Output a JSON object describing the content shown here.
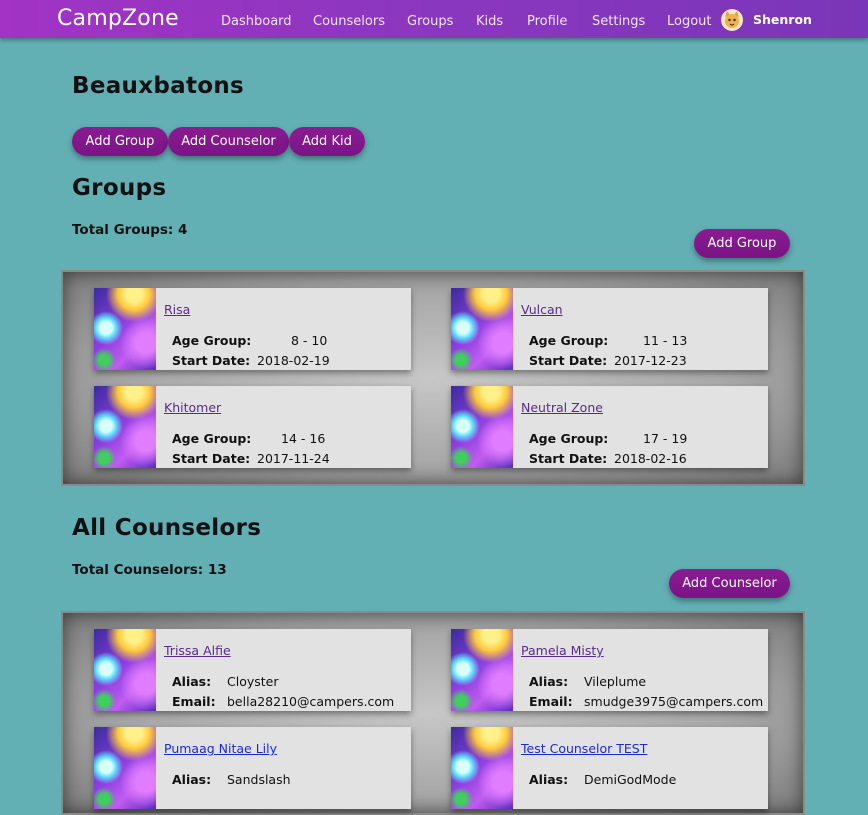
{
  "nav": {
    "brand": "CampZone",
    "links": [
      "Dashboard",
      "Counselors",
      "Groups",
      "Kids",
      "Profile",
      "Settings",
      "Logout"
    ],
    "user": "Shenron"
  },
  "camp": {
    "name": "Beauxbatons",
    "actions": [
      "Add Group",
      "Add Counselor",
      "Add Kid"
    ]
  },
  "groups": {
    "heading": "Groups",
    "total": "Total Groups: 4",
    "add_label": "Add Group",
    "age_label": "Age Group:",
    "start_label": "Start Date:",
    "items": [
      {
        "name": "Risa",
        "age": "8 - 10",
        "start": "2018-02-19"
      },
      {
        "name": "Vulcan",
        "age": "11 - 13",
        "start": "2017-12-23"
      },
      {
        "name": "Khitomer",
        "age": "14 - 16",
        "start": "2017-11-24"
      },
      {
        "name": "Neutral Zone",
        "age": "17 - 19",
        "start": "2018-02-16"
      }
    ]
  },
  "counselors": {
    "heading": "All Counselors",
    "total": "Total Counselors: 13",
    "add_label": "Add Counselor",
    "alias_label": "Alias:",
    "email_label": "Email:",
    "items": [
      {
        "name": "Trissa Alfie",
        "alias": "Cloyster",
        "email": "bella28210@campers.com"
      },
      {
        "name": "Pamela Misty",
        "alias": "Vileplume",
        "email": "smudge3975@campers.com"
      },
      {
        "name": "Pumaag Nitae Lily",
        "alias": "Sandslash",
        "email": ""
      },
      {
        "name": "Test Counselor TEST",
        "alias": "DemiGodMode",
        "email": ""
      }
    ]
  },
  "colors": {
    "background": "#62afb4",
    "navbar": "#8a37bf",
    "button": "#801489",
    "card": "#e2e2e2"
  }
}
